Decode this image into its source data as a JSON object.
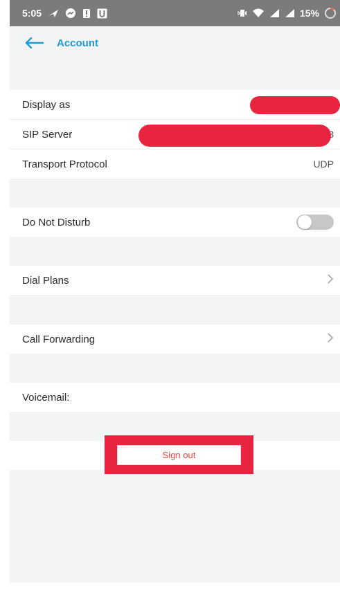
{
  "status_bar": {
    "time": "5:05",
    "battery_percent": "15%",
    "icons_left": [
      "navigation-arrow-icon",
      "messenger-icon",
      "alert-icon",
      "u-app-icon"
    ],
    "icons_right": [
      "vibrate-icon",
      "wifi-icon",
      "signal-icon",
      "signal-icon-2",
      "battery-icon"
    ]
  },
  "app_bar": {
    "title": "Account"
  },
  "rows": {
    "display_as": {
      "label": "Display as"
    },
    "sip_server": {
      "label": "SIP Server",
      "value_tail": "3"
    },
    "transport": {
      "label": "Transport Protocol",
      "value": "UDP"
    },
    "dnd": {
      "label": "Do Not Disturb",
      "enabled": false
    },
    "dial_plans": {
      "label": "Dial Plans"
    },
    "call_forwarding": {
      "label": "Call Forwarding"
    },
    "voicemail": {
      "label": "Voicemail:"
    }
  },
  "sign_out": {
    "label": "Sign out"
  },
  "colors": {
    "accent": "#1e9bd2",
    "redaction": "#e8243e",
    "background": "#f3f4f6"
  }
}
